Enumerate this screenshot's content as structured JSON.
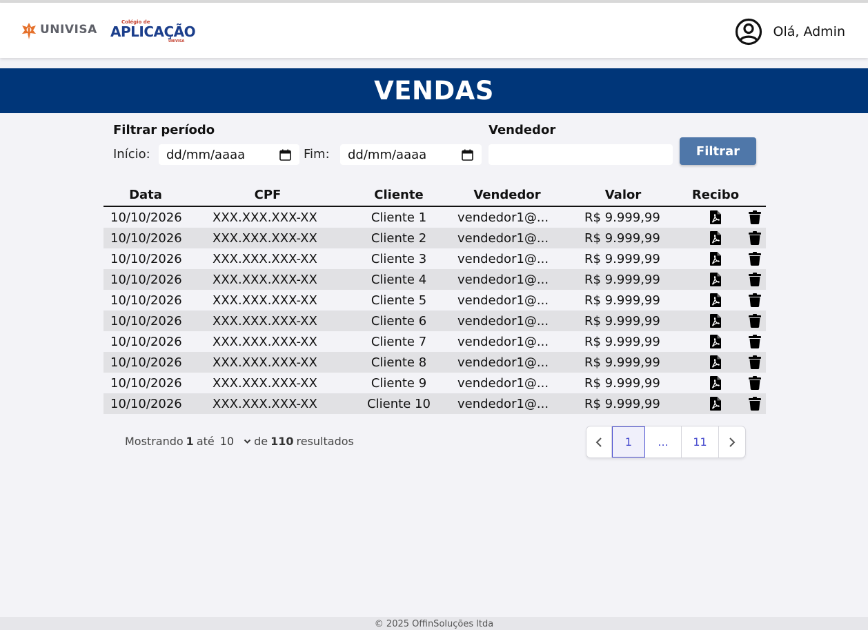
{
  "header": {
    "logo_univisa": "UNIVISA",
    "logo_aplicacao_small": "Colégio de",
    "logo_aplicacao": "APLICAÇÃO",
    "logo_aplicacao_sub": "UNIVISA",
    "greeting": "Olá, Admin"
  },
  "page_title": "VENDAS",
  "filters": {
    "period_label": "Filtrar período",
    "start_label": "Início:",
    "start_value": "dd/mm/aaaa",
    "end_label": "Fim:",
    "end_value": "dd/mm/aaaa",
    "seller_label": "Vendedor",
    "seller_value": "",
    "filter_button": "Filtrar"
  },
  "table": {
    "columns": [
      "Data",
      "CPF",
      "Cliente",
      "Vendedor",
      "Valor",
      "Recibo"
    ],
    "rows": [
      {
        "data": "10/10/2026",
        "cpf": "XXX.XXX.XXX-XX",
        "cliente": "Cliente 1",
        "vendedor": "vendedor1@...",
        "valor": "R$ 9.999,99"
      },
      {
        "data": "10/10/2026",
        "cpf": "XXX.XXX.XXX-XX",
        "cliente": "Cliente 2",
        "vendedor": "vendedor1@...",
        "valor": "R$ 9.999,99"
      },
      {
        "data": "10/10/2026",
        "cpf": "XXX.XXX.XXX-XX",
        "cliente": "Cliente 3",
        "vendedor": "vendedor1@...",
        "valor": "R$ 9.999,99"
      },
      {
        "data": "10/10/2026",
        "cpf": "XXX.XXX.XXX-XX",
        "cliente": "Cliente 4",
        "vendedor": "vendedor1@...",
        "valor": "R$ 9.999,99"
      },
      {
        "data": "10/10/2026",
        "cpf": "XXX.XXX.XXX-XX",
        "cliente": "Cliente 5",
        "vendedor": "vendedor1@...",
        "valor": "R$ 9.999,99"
      },
      {
        "data": "10/10/2026",
        "cpf": "XXX.XXX.XXX-XX",
        "cliente": "Cliente 6",
        "vendedor": "vendedor1@...",
        "valor": "R$ 9.999,99"
      },
      {
        "data": "10/10/2026",
        "cpf": "XXX.XXX.XXX-XX",
        "cliente": "Cliente 7",
        "vendedor": "vendedor1@...",
        "valor": "R$ 9.999,99"
      },
      {
        "data": "10/10/2026",
        "cpf": "XXX.XXX.XXX-XX",
        "cliente": "Cliente 8",
        "vendedor": "vendedor1@...",
        "valor": "R$ 9.999,99"
      },
      {
        "data": "10/10/2026",
        "cpf": "XXX.XXX.XXX-XX",
        "cliente": "Cliente 9",
        "vendedor": "vendedor1@...",
        "valor": "R$ 9.999,99"
      },
      {
        "data": "10/10/2026",
        "cpf": "XXX.XXX.XXX-XX",
        "cliente": "Cliente 10",
        "vendedor": "vendedor1@...",
        "valor": "R$ 9.999,99"
      }
    ],
    "row_icons": [
      "pdf-icon",
      "trash-icon"
    ]
  },
  "pagination": {
    "showing_prefix": "Mostrando",
    "from": "1",
    "until": "até",
    "per_page": "10",
    "of": "de",
    "total": "110",
    "results": "resultados",
    "pages": [
      "1",
      "...",
      "11"
    ],
    "current_page": "1"
  },
  "footer": "© 2025 OffinSoluções ltda",
  "colors": {
    "banner": "#003679",
    "filter_button": "#4f77a9",
    "pager_accent": "#4b4fcf",
    "stripe": "#e1e1e4"
  }
}
